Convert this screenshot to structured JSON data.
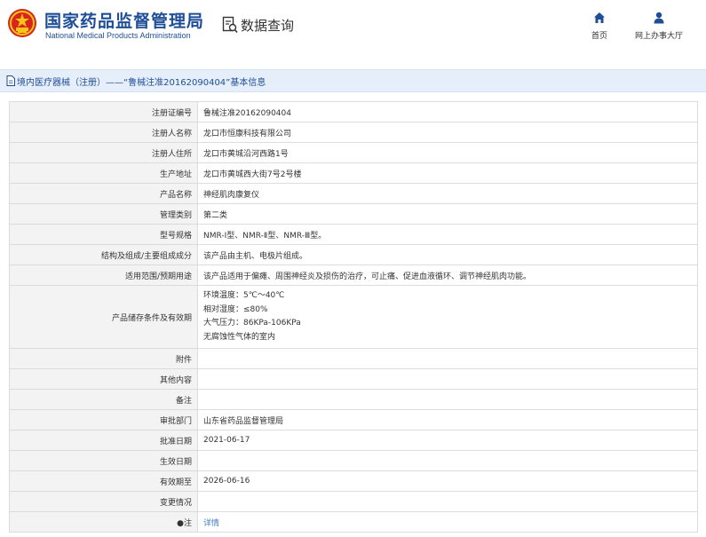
{
  "header": {
    "org_name_cn": "国家药品监督管理局",
    "org_name_en": "National Medical Products Administration",
    "query_label": "数据查询",
    "nav": [
      {
        "label": "首页",
        "icon": "home-icon"
      },
      {
        "label": "网上办事大厅",
        "icon": "user-icon"
      }
    ]
  },
  "title_bar": {
    "icon": "document-icon",
    "text": "境内医疗器械（注册）——“鲁械注准20162090404”基本信息"
  },
  "record": {
    "rows": [
      {
        "label": "注册证编号",
        "value": "鲁械注准20162090404"
      },
      {
        "label": "注册人名称",
        "value": "龙口市恒康科技有限公司"
      },
      {
        "label": "注册人住所",
        "value": "龙口市黄城沿河西路1号"
      },
      {
        "label": "生产地址",
        "value": "龙口市黄城西大街7号2号楼"
      },
      {
        "label": "产品名称",
        "value": "神经肌肉康复仪"
      },
      {
        "label": "管理类别",
        "value": "第二类"
      },
      {
        "label": "型号规格",
        "value": "NMR-Ⅰ型、NMR-Ⅱ型、NMR-Ⅲ型。"
      },
      {
        "label": "结构及组成/主要组成成分",
        "value": "该产品由主机、电极片组成。"
      },
      {
        "label": "适用范围/预期用途",
        "value": "该产品适用于偏瘫、周围神经炎及损伤的治疗，可止痛、促进血液循环、调节神经肌肉功能。"
      }
    ],
    "storage": {
      "label": "产品储存条件及有效期",
      "lines": [
        "环境温度：5℃～40℃",
        "相对湿度：≤80%",
        "大气压力：86KPa-106KPa",
        "无腐蚀性气体的室内"
      ]
    },
    "rows2": [
      {
        "label": "附件",
        "value": ""
      },
      {
        "label": "其他内容",
        "value": ""
      },
      {
        "label": "备注",
        "value": ""
      },
      {
        "label": "审批部门",
        "value": "山东省药品监督管理局"
      },
      {
        "label": "批准日期",
        "value": "2021-06-17"
      },
      {
        "label": "生效日期",
        "value": ""
      },
      {
        "label": "有效期至",
        "value": "2026-06-16"
      },
      {
        "label": "变更情况",
        "value": ""
      }
    ],
    "note": {
      "label": "●注",
      "link": "详情"
    }
  },
  "colors": {
    "brand_blue": "#1f4e96",
    "title_bar_bg": "#e6eff9",
    "label_bg": "#f3f3f3",
    "link": "#3e7bc7",
    "emblem_red": "#d8251d",
    "emblem_gold": "#f5c518"
  }
}
